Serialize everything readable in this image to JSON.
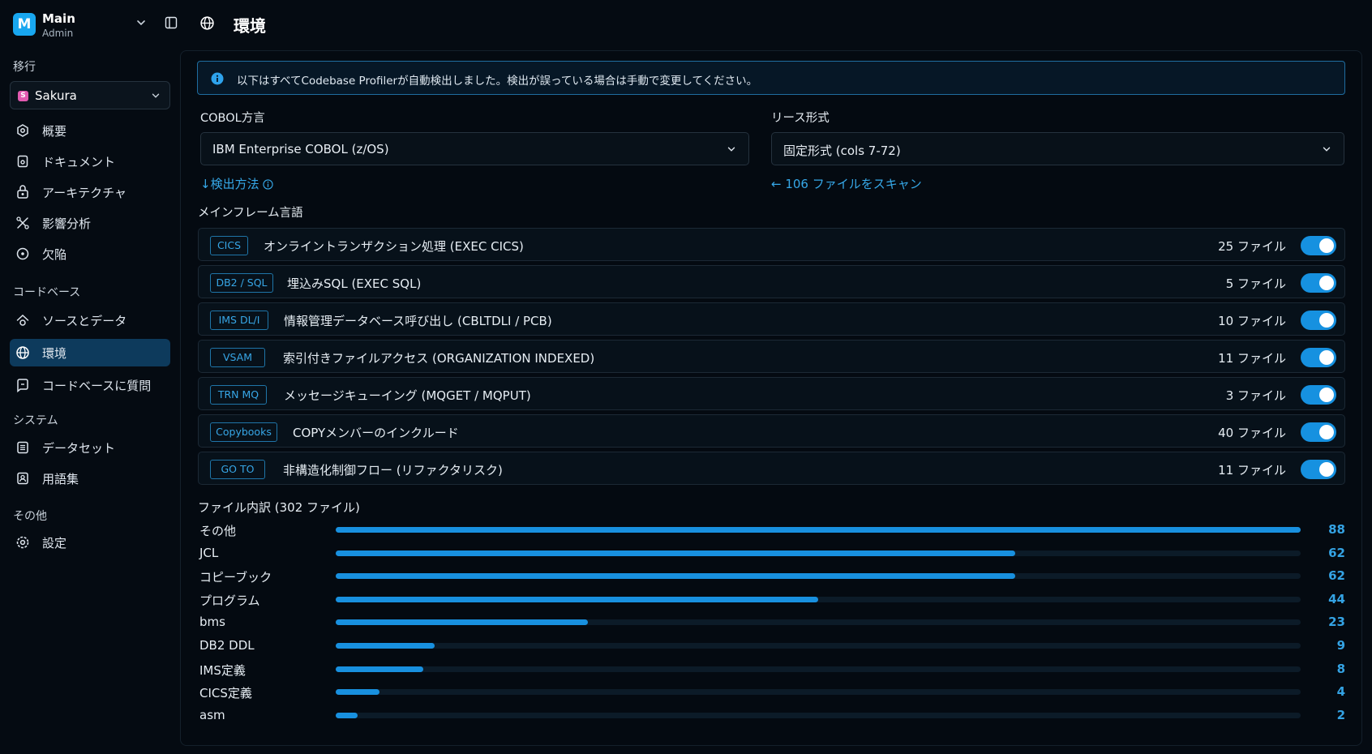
{
  "workspace": {
    "initial": "M",
    "name": "Main",
    "role": "Admin"
  },
  "sidebar": {
    "section_migration": "移行",
    "project": {
      "badge": "S",
      "name": "Sakura"
    },
    "migration_items": [
      {
        "label": "概要",
        "icon": "overview-icon"
      },
      {
        "label": "ドキュメント",
        "icon": "document-icon"
      },
      {
        "label": "アーキテクチャ",
        "icon": "architecture-icon"
      },
      {
        "label": "影響分析",
        "icon": "impact-analysis-icon"
      },
      {
        "label": "欠陥",
        "icon": "defect-icon"
      }
    ],
    "section_codebase": "コードベース",
    "codebase_items": [
      {
        "label": "ソースとデータ",
        "icon": "source-data-icon"
      },
      {
        "label": "環境",
        "icon": "globe-icon",
        "active": true
      },
      {
        "label": "コードベースに質問",
        "icon": "ask-icon"
      }
    ],
    "section_system": "システム",
    "system_items": [
      {
        "label": "データセット",
        "icon": "dataset-icon"
      },
      {
        "label": "用語集",
        "icon": "glossary-icon"
      }
    ],
    "section_other": "その他",
    "other_items": [
      {
        "label": "設定",
        "icon": "settings-icon"
      }
    ]
  },
  "header": {
    "title": "環境"
  },
  "alert": {
    "text": "以下はすべてCodebase Profilerが自動検出しました。検出が誤っている場合は手動で変更してください。"
  },
  "dialect": {
    "label": "COBOL方言",
    "value": "IBM Enterprise COBOL (z/OS)",
    "link": "↓検出方法"
  },
  "source_format": {
    "label": "リース形式",
    "value": "固定形式 (cols 7-72)",
    "link": "← 106 ファイルをスキャン"
  },
  "languages": {
    "title": "メインフレーム言語",
    "rows": [
      {
        "tag": "CICS",
        "desc": "オンライントランザクション処理 (EXEC CICS)",
        "count": "25 ファイル",
        "enabled": true
      },
      {
        "tag": "DB2 / SQL",
        "desc": "埋込みSQL (EXEC SQL)",
        "count": "5 ファイル",
        "enabled": true
      },
      {
        "tag": "IMS DL/I",
        "desc": "情報管理データベース呼び出し (CBLTDLI / PCB)",
        "count": "10 ファイル",
        "enabled": true
      },
      {
        "tag": "VSAM",
        "desc": "索引付きファイルアクセス (ORGANIZATION INDEXED)",
        "count": "11 ファイル",
        "enabled": true
      },
      {
        "tag": "TRN MQ",
        "desc": "メッセージキューイング (MQGET / MQPUT)",
        "count": "3 ファイル",
        "enabled": true
      },
      {
        "tag": "Copybooks",
        "desc": "COPYメンバーのインクルード",
        "count": "40 ファイル",
        "enabled": true
      },
      {
        "tag": "GO TO",
        "desc": "非構造化制御フロー (リファクタリスク)",
        "count": "11 ファイル",
        "enabled": true
      }
    ]
  },
  "breakdown": {
    "title": "ファイル内訳 (302 ファイル)",
    "max": 88,
    "rows": [
      {
        "name": "その他",
        "value": 88
      },
      {
        "name": "JCL",
        "value": 62
      },
      {
        "name": "コピーブック",
        "value": 62
      },
      {
        "name": "プログラム",
        "value": 44
      },
      {
        "name": "bms",
        "value": 23
      },
      {
        "name": "DB2 DDL",
        "value": 9
      },
      {
        "name": "IMS定義",
        "value": 8
      },
      {
        "name": "CICS定義",
        "value": 4
      },
      {
        "name": "asm",
        "value": 2
      }
    ]
  },
  "colors": {
    "accent": "#1890df",
    "link": "#36a8e8",
    "active_nav": "#0d3a5c",
    "background": "#050b12"
  }
}
